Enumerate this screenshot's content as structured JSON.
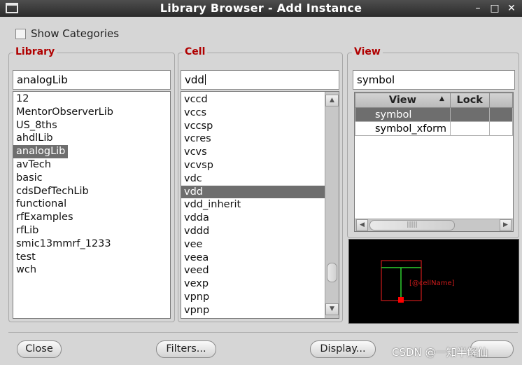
{
  "window": {
    "title": "Library Browser - Add Instance"
  },
  "show_categories": {
    "label": "Show Categories",
    "checked": false
  },
  "library": {
    "group_title": "Library",
    "filter_value": "analogLib",
    "items": [
      "12",
      "MentorObserverLib",
      "US_8ths",
      "ahdlLib",
      "analogLib",
      "avTech",
      "basic",
      "cdsDefTechLib",
      "functional",
      "rfExamples",
      "rfLib",
      "smic13mmrf_1233",
      "test",
      "wch"
    ],
    "selected": "analogLib"
  },
  "cell": {
    "group_title": "Cell",
    "filter_value": "vdd",
    "items": [
      "vccd",
      "vccs",
      "vccsp",
      "vcres",
      "vcvs",
      "vcvsp",
      "vdc",
      "vdd",
      "vdd_inherit",
      "vdda",
      "vddd",
      "vee",
      "veea",
      "veed",
      "vexp",
      "vpnp",
      "vpnp"
    ],
    "selected": "vdd"
  },
  "view": {
    "group_title": "View",
    "filter_value": "symbol",
    "columns": [
      "View",
      "Lock"
    ],
    "rows": [
      {
        "view": "symbol",
        "lock": ""
      },
      {
        "view": "symbol_xform",
        "lock": ""
      }
    ],
    "selected": "symbol",
    "hscroll_marker": "|||||"
  },
  "preview": {
    "label": "[@cellName]",
    "colors": {
      "background": "#000000",
      "outline": "#cc1b1b",
      "pin_line": "#2fd12f",
      "pin": "#ff0000"
    }
  },
  "buttons": {
    "close": "Close",
    "filters": "Filters...",
    "display": "Display..."
  },
  "watermark": {
    "text": "CSDN @一知半解仙"
  },
  "colors": {
    "group_title": "#b00000",
    "selection": "#6e6e6e",
    "titlebar": "#2b2b2b"
  }
}
